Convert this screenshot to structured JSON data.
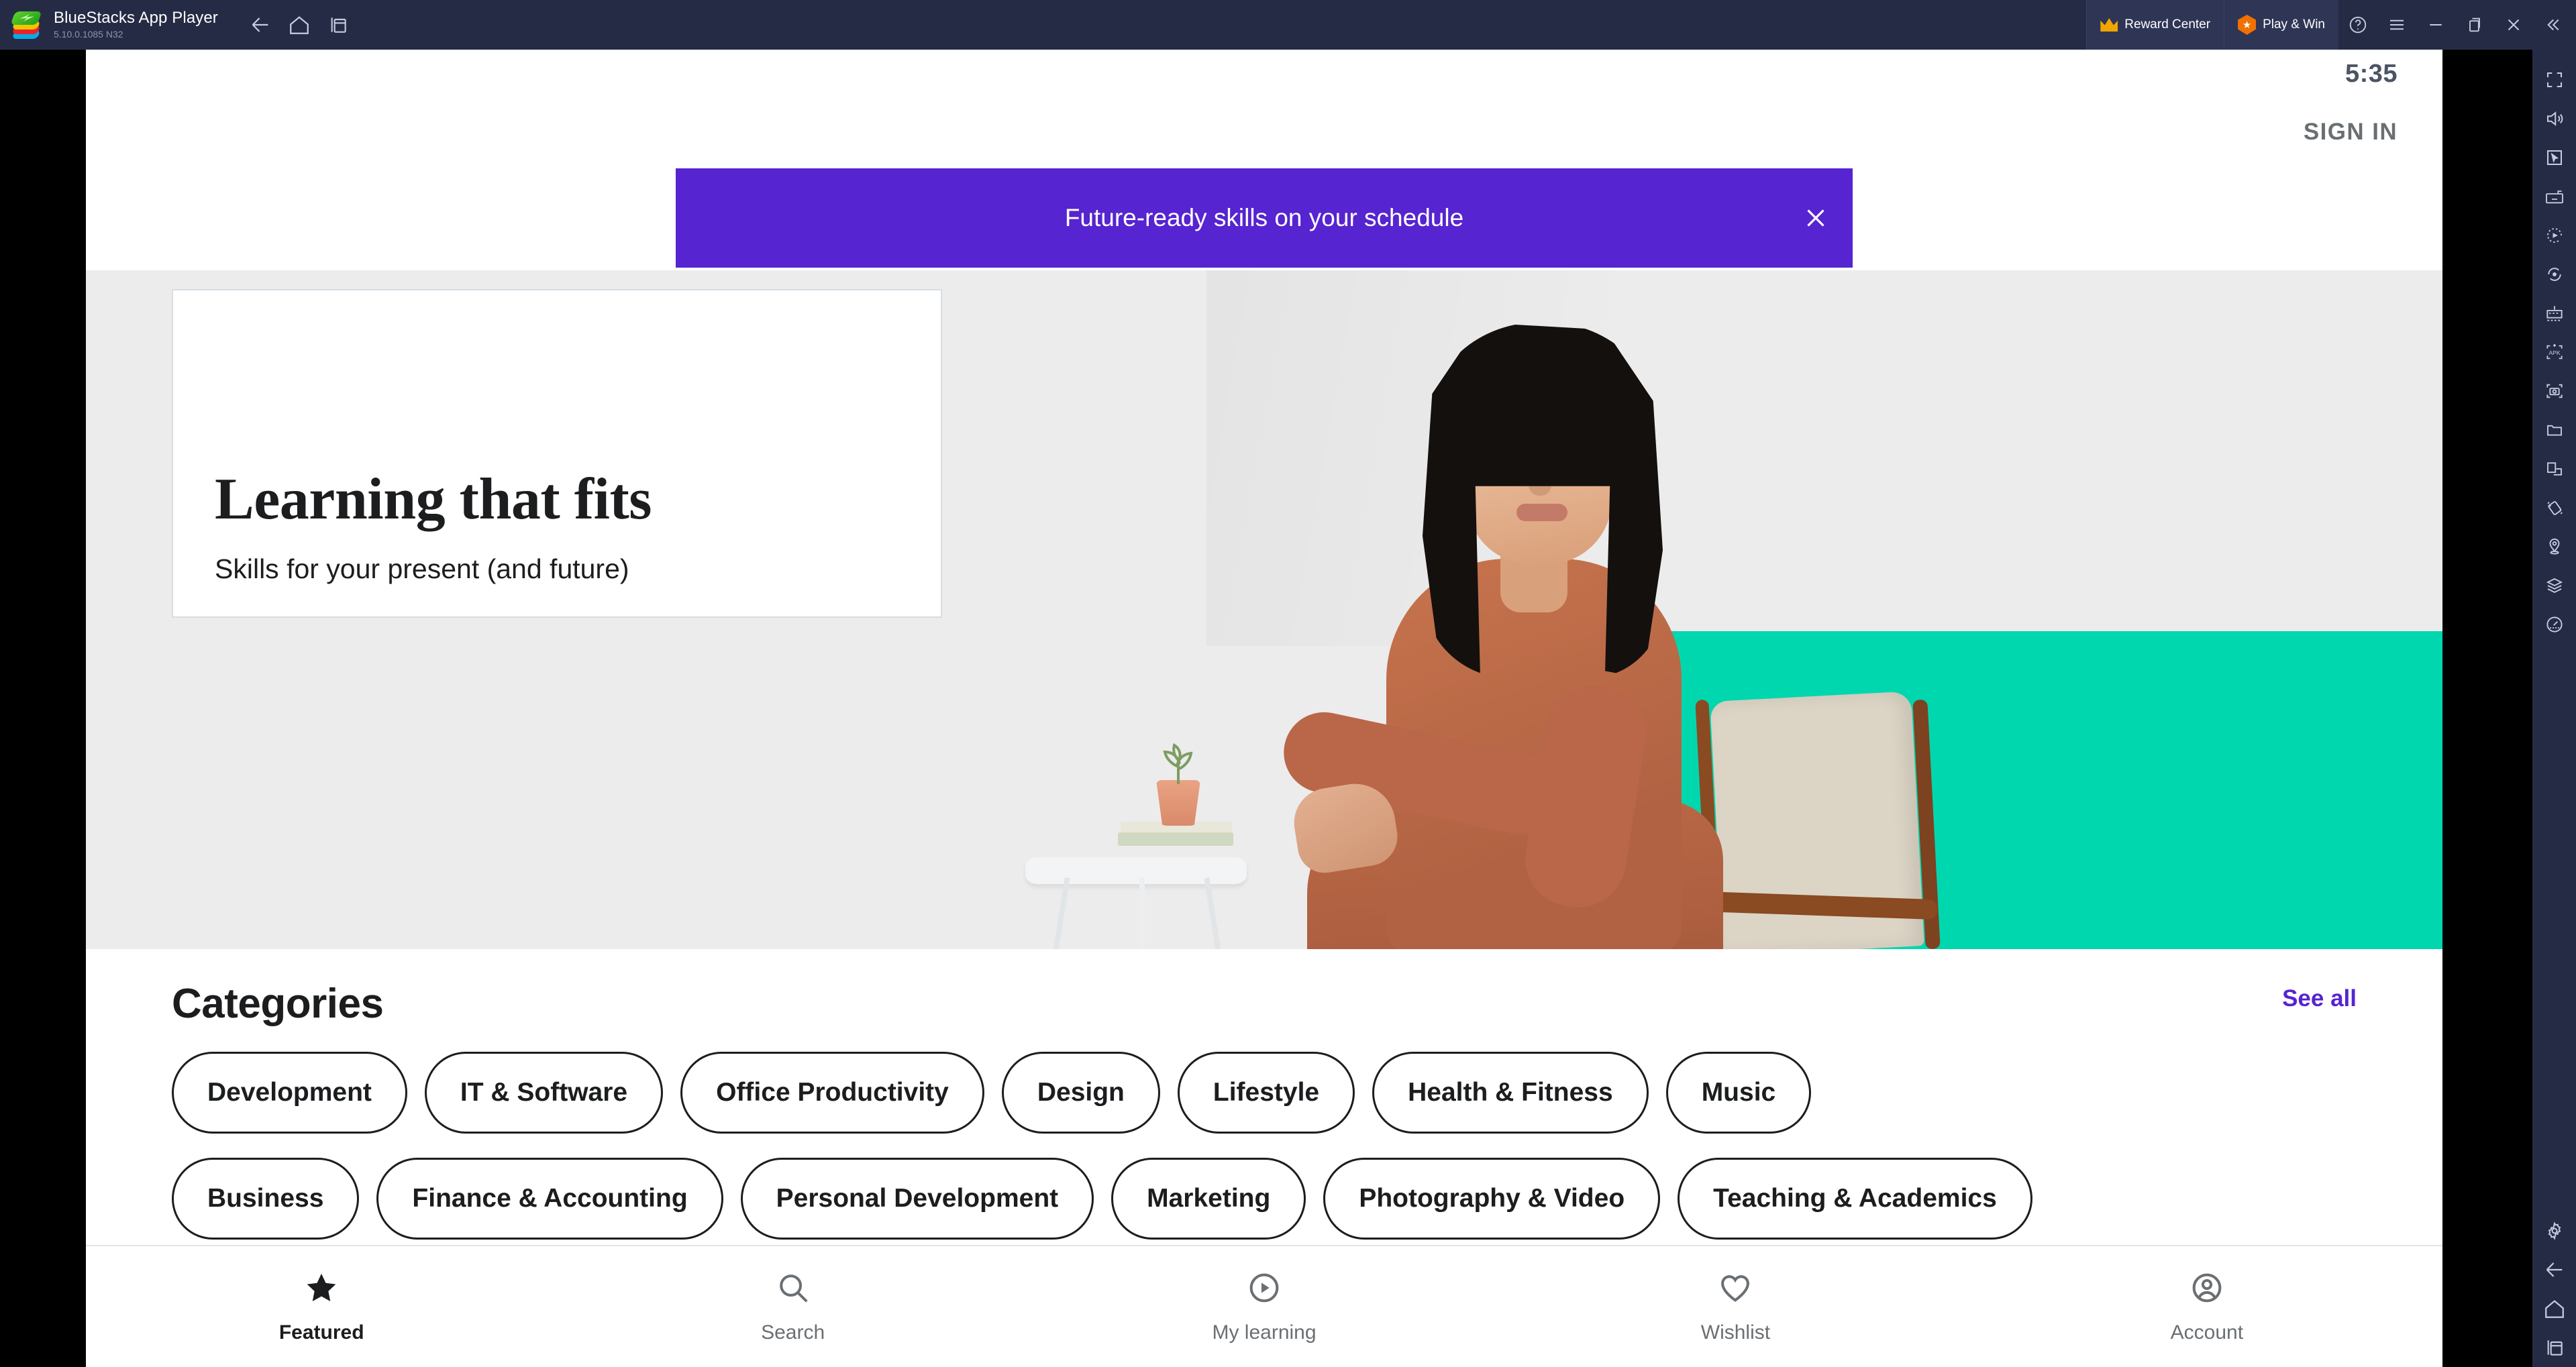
{
  "window": {
    "app_name": "BlueStacks App Player",
    "version": "5.10.0.1085  N32",
    "logo_icon": "bluestacks-logo-icon",
    "nav": {
      "back_icon": "back-arrow-icon",
      "home_icon": "home-icon",
      "multi_instance_icon": "multi-instance-icon"
    },
    "reward_center": {
      "label": "Reward Center",
      "icon": "crown-icon"
    },
    "play_and_win": {
      "label": "Play & Win",
      "icon": "star-badge-icon"
    },
    "controls": {
      "help_icon": "help-circle-icon",
      "menu_icon": "hamburger-menu-icon",
      "minimize_icon": "minimize-icon",
      "maximize_icon": "maximize-restore-icon",
      "close_icon": "close-x-icon",
      "collapse_icon": "double-chevron-left-icon"
    }
  },
  "sidebar": {
    "items": [
      {
        "icon": "fullscreen-icon",
        "name": "fullscreen"
      },
      {
        "icon": "volume-icon",
        "name": "volume"
      },
      {
        "icon": "cursor-box-icon",
        "name": "game-controls"
      },
      {
        "icon": "keyboard-icon",
        "name": "keymapping"
      },
      {
        "icon": "macro-record-icon",
        "name": "macro-recorder"
      },
      {
        "icon": "rotate-icon",
        "name": "rotate"
      },
      {
        "icon": "multi-instance-sync-icon",
        "name": "multi-instance-sync"
      },
      {
        "icon": "install-apk-icon",
        "name": "install-apk"
      },
      {
        "icon": "screenshot-icon",
        "name": "screenshot"
      },
      {
        "icon": "folder-icon",
        "name": "media-manager"
      },
      {
        "icon": "pip-icon",
        "name": "picture-in-picture"
      },
      {
        "icon": "shake-icon",
        "name": "shake"
      },
      {
        "icon": "location-icon",
        "name": "location"
      },
      {
        "icon": "layers-icon",
        "name": "layers"
      },
      {
        "icon": "performance-icon",
        "name": "performance"
      },
      {
        "icon": "gear-icon",
        "name": "settings"
      },
      {
        "icon": "back-arrow-icon",
        "name": "back"
      },
      {
        "icon": "home-icon",
        "name": "home"
      },
      {
        "icon": "recent-apps-icon",
        "name": "recent-apps"
      }
    ]
  },
  "app": {
    "status_time": "5:35",
    "sign_in_label": "SIGN IN",
    "promo": {
      "message": "Future-ready skills on your schedule",
      "close_icon": "close-x-icon",
      "background_color": "#5624D0"
    },
    "hero": {
      "headline": "Learning that fits",
      "subhead": "Skills for your present (and future)",
      "accent_color": "#00D7AE",
      "background_color": "#ECECEC"
    },
    "categories": {
      "title": "Categories",
      "see_all_label": "See all",
      "see_all_color": "#5624D0",
      "row1": [
        "Development",
        "IT & Software",
        "Office Productivity",
        "Design",
        "Lifestyle",
        "Health & Fitness",
        "Music"
      ],
      "row2": [
        "Business",
        "Finance & Accounting",
        "Personal Development",
        "Marketing",
        "Photography & Video",
        "Teaching & Academics"
      ]
    },
    "bottom_nav": [
      {
        "label": "Featured",
        "icon": "star-icon",
        "active": true
      },
      {
        "label": "Search",
        "icon": "search-icon",
        "active": false
      },
      {
        "label": "My learning",
        "icon": "play-circle-icon",
        "active": false
      },
      {
        "label": "Wishlist",
        "icon": "heart-icon",
        "active": false
      },
      {
        "label": "Account",
        "icon": "account-icon",
        "active": false
      }
    ]
  }
}
